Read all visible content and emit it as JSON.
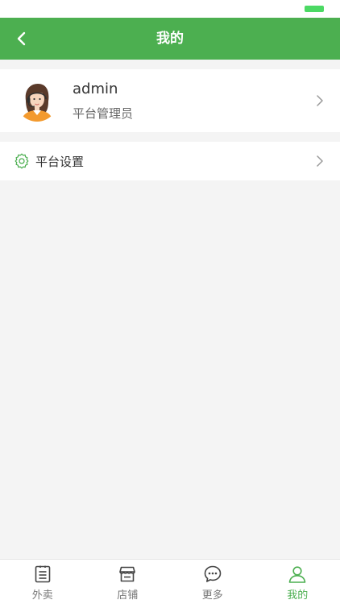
{
  "header": {
    "title": "我的",
    "back_icon": "chevron-left-icon"
  },
  "profile": {
    "name": "admin",
    "role": "平台管理员",
    "avatar_icon": "avatar-woman-headset"
  },
  "settings": {
    "label": "平台设置",
    "icon": "gear-icon"
  },
  "tabs": [
    {
      "label": "外卖",
      "icon": "list-icon",
      "active": false
    },
    {
      "label": "店铺",
      "icon": "store-icon",
      "active": false
    },
    {
      "label": "更多",
      "icon": "chat-bubble-icon",
      "active": false
    },
    {
      "label": "我的",
      "icon": "user-icon",
      "active": true
    }
  ],
  "colors": {
    "brand": "#4caf50",
    "battery": "#4cd964",
    "background": "#f4f4f4"
  }
}
